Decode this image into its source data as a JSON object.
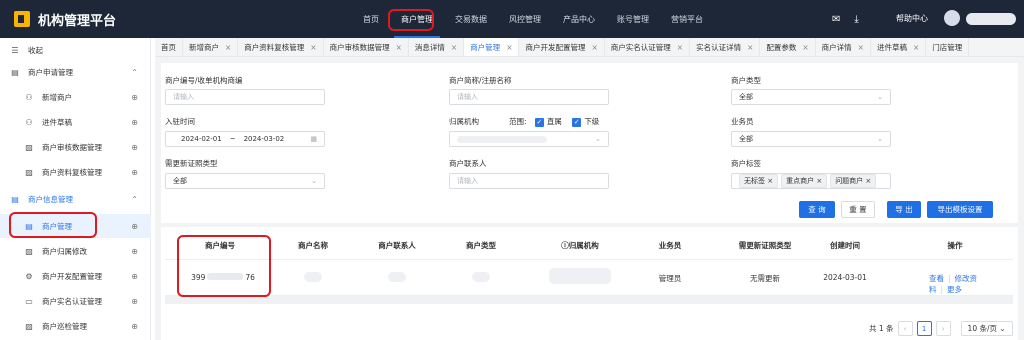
{
  "app": {
    "title": "机构管理平台"
  },
  "nav": {
    "items": [
      "首页",
      "商户管理",
      "交易数据",
      "风控管理",
      "产品中心",
      "账号管理",
      "营销平台"
    ],
    "active": "商户管理"
  },
  "header": {
    "mail_icon": "mail-icon",
    "download_icon": "download-icon",
    "help": "帮助中心"
  },
  "sidebar": {
    "collapse": "收起",
    "group1": "商户申请管理",
    "g1_items": [
      "新增商户",
      "进件草稿",
      "商户审核数据管理",
      "商户资料复核管理"
    ],
    "group2": "商户信息管理",
    "g2_items": [
      "商户管理",
      "商户归属修改",
      "商户开发配置管理",
      "商户实名认证管理",
      "商户巡检管理"
    ]
  },
  "tabs": [
    "首页",
    "新增商户",
    "商户资料复核管理",
    "商户审核数据管理",
    "消息详情",
    "商户管理",
    "商户开发配置管理",
    "商户实名认证管理",
    "实名认证详情",
    "配置参数",
    "商户详情",
    "进件草稿",
    "门店管理"
  ],
  "filters": {
    "merchant_no": {
      "label": "商户编号/收单机构商编",
      "placeholder": "请输入"
    },
    "short_name": {
      "label": "商户简称/注册名称",
      "placeholder": "请输入"
    },
    "type": {
      "label": "商户类型",
      "value": "全部"
    },
    "join_time": {
      "label": "入驻时间",
      "start": "2024-02-01",
      "sep": "~",
      "end": "2024-03-02"
    },
    "org": {
      "label": "归属机构",
      "range_label": "范围:",
      "opt1": "直属",
      "opt2": "下级"
    },
    "salesman": {
      "label": "业务员",
      "value": "全部"
    },
    "renew": {
      "label": "需更新证照类型",
      "value": "全部"
    },
    "contact": {
      "label": "商户联系人",
      "placeholder": "请输入"
    },
    "tags": {
      "label": "商户标签",
      "chips": [
        "无标签",
        "重点商户",
        "问题商户"
      ]
    }
  },
  "buttons": {
    "query": "查 询",
    "reset": "重 置",
    "export": "导 出",
    "export_tpl": "导出模板设置"
  },
  "table": {
    "headers": [
      "商户编号",
      "商户名称",
      "商户联系人",
      "商户类型",
      "归属机构",
      "业务员",
      "需更新证照类型",
      "创建时间",
      "操作"
    ],
    "row": {
      "no_prefix": "399",
      "no_suffix": "76",
      "salesman": "管理员",
      "renew": "无需更新",
      "created": "2024-03-01",
      "actions": [
        "查看",
        "修改资料",
        "更多"
      ]
    }
  },
  "pagination": {
    "total": "共 1 条",
    "current": "1",
    "size": "10 条/页"
  }
}
